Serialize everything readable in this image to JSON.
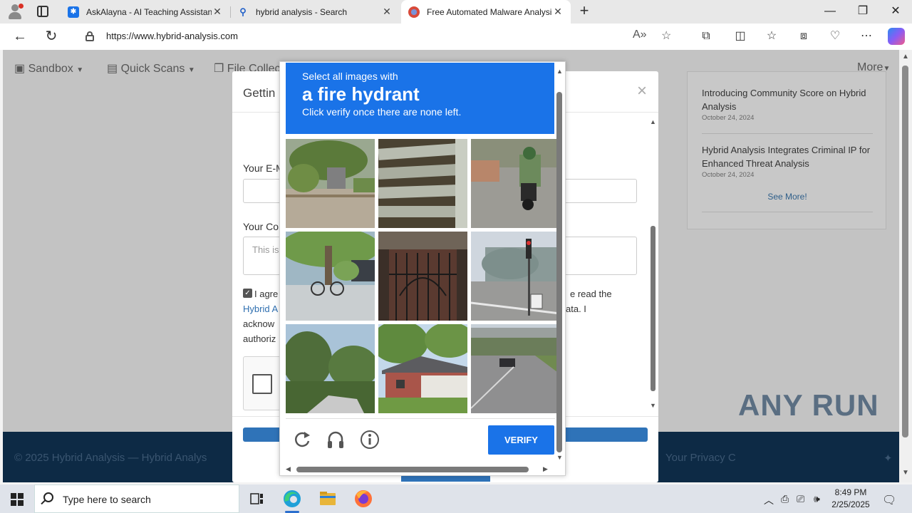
{
  "browser": {
    "tabs": [
      {
        "label": "AskAlayna - AI Teaching Assistan",
        "icon": "asterisk-app-icon"
      },
      {
        "label": "hybrid analysis - Search",
        "icon": "search-icon"
      },
      {
        "label": "Free Automated Malware Analysi",
        "icon": "hybrid-analysis-icon",
        "active": true
      }
    ],
    "url_host": "https://www.hybrid-analysis.com",
    "window_controls": {
      "minimize": "—",
      "restore": "❐",
      "close": "✕"
    }
  },
  "site": {
    "nav": [
      {
        "label": "Sandbox",
        "icon": "cube-icon"
      },
      {
        "label": "Quick Scans",
        "icon": "file-icon"
      },
      {
        "label": "File Collec",
        "icon": "copy-icon"
      },
      {
        "label": "More"
      }
    ],
    "news": [
      {
        "title": "Introducing Community Score on Hybrid Analysis",
        "date": "October 24, 2024"
      },
      {
        "title": "Hybrid Analysis Integrates Criminal IP for Enhanced Threat Analysis",
        "date": "October 24, 2024"
      }
    ],
    "see_more": "See More!",
    "footer_left": "© 2025 Hybrid Analysis — Hybrid Analys",
    "footer_right": "Your Privacy C",
    "watermark": "ANY RUN"
  },
  "modal": {
    "title": "Gettin",
    "email_label": "Your E-M",
    "comment_label": "Your Co",
    "comment_placeholder": "This is",
    "agree_line1_left": "I agre",
    "agree_line1_right": "e read the",
    "agree_link": "Hybrid A",
    "agree_line2_right": "ata. I",
    "agree_line3": "acknow",
    "agree_line4": "authoriz",
    "close": "×"
  },
  "captcha": {
    "instruction_line1": "Select all images with",
    "target": "a fire hydrant",
    "instruction_line3": "Click verify once there are none left.",
    "verify_label": "VERIFY",
    "tiles": [
      "tile-tree-stump-street",
      "tile-wooden-fence-slats",
      "tile-motorcycle-rider-road",
      "tile-tree-bicycle-sidewalk",
      "tile-iron-gate",
      "tile-traffic-light-intersection",
      "tile-palm-trees-rooftop",
      "tile-brick-house-lawn",
      "tile-highway-overpass"
    ]
  },
  "taskbar": {
    "search_placeholder": "Type here to search",
    "time": "8:49 PM",
    "date": "2/25/2025"
  }
}
